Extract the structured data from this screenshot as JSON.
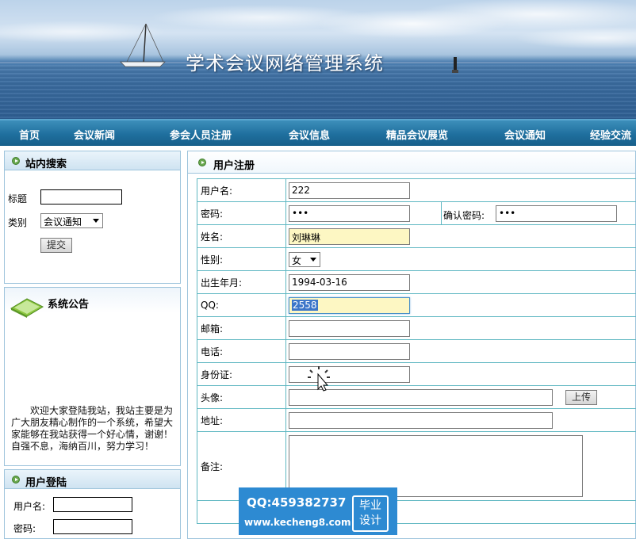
{
  "banner": {
    "title": "学术会议网络管理系统"
  },
  "nav": {
    "items": [
      "首页",
      "会议新闻",
      "参会人员注册",
      "会议信息",
      "精品会议展览",
      "会议通知",
      "经验交流"
    ]
  },
  "search": {
    "title": "站内搜索",
    "title_label": "标题",
    "title_value": "",
    "category_label": "类别",
    "category_selected": "会议通知",
    "submit_label": "提交"
  },
  "notice": {
    "title": "系统公告",
    "text": "欢迎大家登陆我站，我站主要是为广大朋友精心制作的一个系统，希望大家能够在我站获得一个好心情，谢谢！　　　自强不息，海纳百川，努力学习！"
  },
  "login": {
    "title": "用户登陆",
    "username_label": "用户名:",
    "password_label": "密码:"
  },
  "register": {
    "title": "用户注册",
    "username_label": "用户名:",
    "username_value": "222",
    "password_label": "密码:",
    "password_value": "•••",
    "confirm_label": "确认密码:",
    "confirm_value": "•••",
    "name_label": "姓名:",
    "name_value": "刘琳琳",
    "gender_label": "性别:",
    "gender_selected": "女",
    "birth_label": "出生年月:",
    "birth_value": "1994-03-16",
    "qq_label": "QQ:",
    "qq_value": "2558",
    "email_label": "邮箱:",
    "email_value": "",
    "phone_label": "电话:",
    "phone_value": "",
    "id_label": "身份证:",
    "id_value": "",
    "avatar_label": "头像:",
    "avatar_value": "",
    "upload_label": "上传",
    "address_label": "地址:",
    "address_value": "",
    "note_label": "备注:",
    "note_value": ""
  },
  "watermark": {
    "qq": "QQ:459382737",
    "url": "www.kecheng8.com",
    "badge_line1": "毕业",
    "badge_line2": "设计"
  },
  "colors": {
    "nav_bg": "#1f6f9e",
    "panel_border": "#9ec4dc",
    "table_border": "#5fb7c2",
    "autofill_yellow": "#fdf7c3",
    "watermark_blue": "#2d8ad2"
  }
}
